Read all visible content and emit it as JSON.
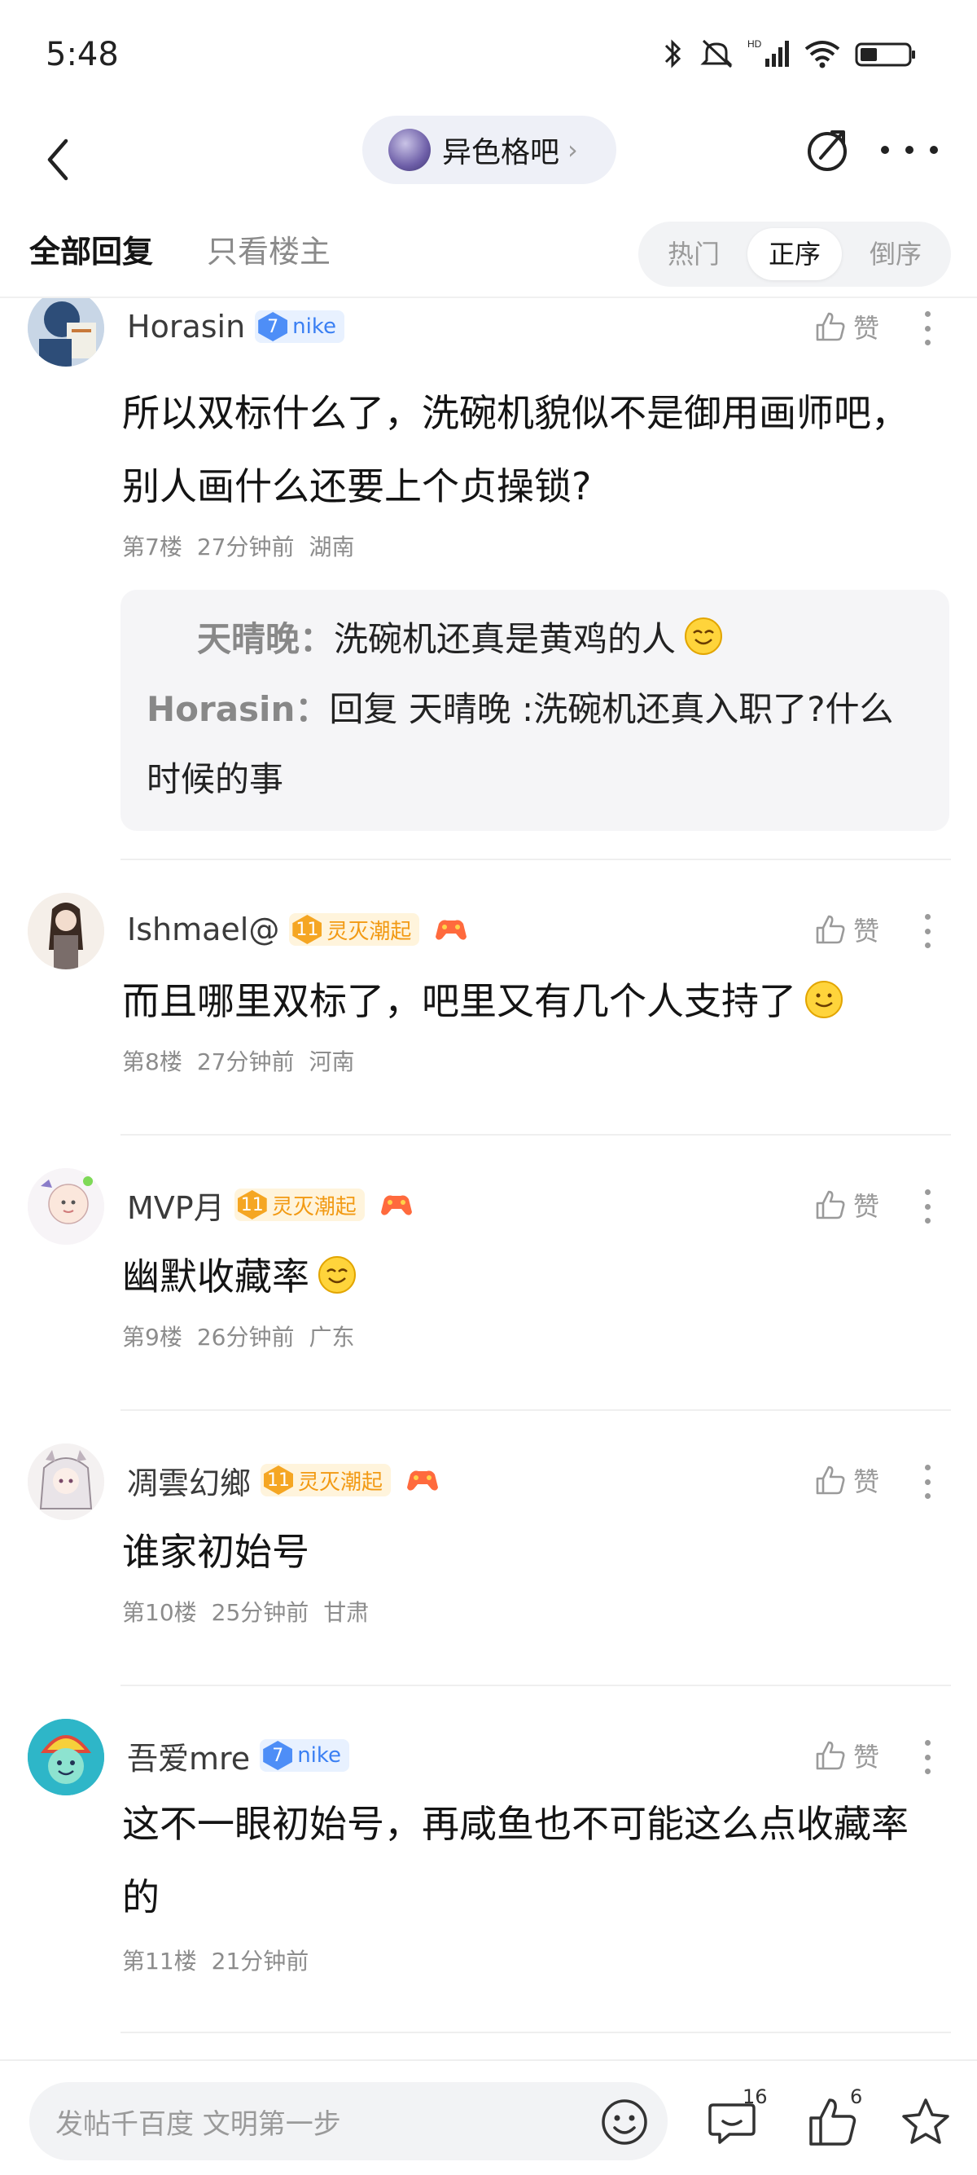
{
  "status_bar": {
    "time": "5:48"
  },
  "nav": {
    "forum_name": "异色格吧"
  },
  "tabs": {
    "all_replies": "全部回复",
    "only_op": "只看楼主",
    "sort": {
      "hot": "热门",
      "asc": "正序",
      "desc": "倒序",
      "selected": "正序"
    }
  },
  "like_label": "赞",
  "posts": [
    {
      "username": "Horasin",
      "level": "7",
      "badge": "nike",
      "badge_color": "blue",
      "content": "所以双标什么了，洗碗机貌似不是御用画师吧，别人画什么还要上个贞操锁?",
      "floor": "第7楼",
      "time": "27分钟前",
      "location": "湖南",
      "replies": [
        {
          "name": "天晴晚：",
          "text": "洗碗机还真是黄鸡的人"
        },
        {
          "name": "Horasin：",
          "text": "回复 天晴晚 :洗碗机还真入职了?什么时候的事"
        }
      ]
    },
    {
      "username": "Ishmael@",
      "level": "11",
      "badge": "灵灭潮起",
      "badge_color": "gold",
      "content": "而且哪里双标了，吧里又有几个人支持了",
      "floor": "第8楼",
      "time": "27分钟前",
      "location": "河南"
    },
    {
      "username": "MVP月",
      "level": "11",
      "badge": "灵灭潮起",
      "badge_color": "gold",
      "content": "幽默收藏率",
      "floor": "第9楼",
      "time": "26分钟前",
      "location": "广东"
    },
    {
      "username": "凋雲幻鄉",
      "level": "11",
      "badge": "灵灭潮起",
      "badge_color": "gold",
      "content": "谁家初始号",
      "floor": "第10楼",
      "time": "25分钟前",
      "location": "甘肃"
    },
    {
      "username": "吾爱mre",
      "level": "7",
      "badge": "nike",
      "badge_color": "blue",
      "content": "这不一眼初始号，再咸鱼也不可能这么点收藏率的",
      "floor": "第11楼",
      "time": "21分钟前",
      "location": ""
    }
  ],
  "bottom_bar": {
    "placeholder": "发帖千百度 文明第一步",
    "comment_count": "16",
    "like_count": "6"
  }
}
